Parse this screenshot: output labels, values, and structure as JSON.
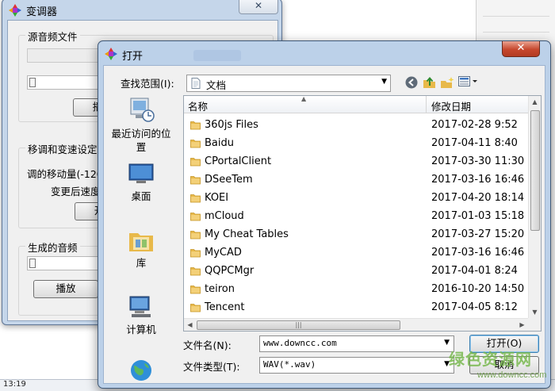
{
  "tuner": {
    "title": "变调器",
    "close_glyph": "✕",
    "source_group": "源音频文件",
    "shift_group": "移调和变速设定",
    "shift_label": "调的移动量(-120",
    "speed_label": "变更后速度",
    "output_group": "生成的音频",
    "play_button": "播放",
    "button_fragment_1": "播",
    "button_fragment_2": "开"
  },
  "dialog": {
    "title": "打开",
    "close_glyph": "✕",
    "lookin_label": "查找范围(I):",
    "lookin_value": "文档",
    "places": [
      {
        "label": "最近访问的位置"
      },
      {
        "label": "桌面"
      },
      {
        "label": "库"
      },
      {
        "label": "计算机"
      }
    ],
    "columns": {
      "name": "名称",
      "date": "修改日期"
    },
    "files": [
      {
        "name": "360js Files",
        "date": "2017-02-28 9:52"
      },
      {
        "name": "Baidu",
        "date": "2017-04-11 8:40"
      },
      {
        "name": "CPortalClient",
        "date": "2017-03-30 11:30"
      },
      {
        "name": "DSeeTem",
        "date": "2017-03-16 16:46"
      },
      {
        "name": "KOEI",
        "date": "2017-04-20 18:14"
      },
      {
        "name": "mCloud",
        "date": "2017-01-03 15:18"
      },
      {
        "name": "My Cheat Tables",
        "date": "2017-03-27 15:20"
      },
      {
        "name": "MyCAD",
        "date": "2017-03-16 16:46"
      },
      {
        "name": "QQPCMgr",
        "date": "2017-04-01 8:24"
      },
      {
        "name": "teiron",
        "date": "2016-10-20 14:50"
      },
      {
        "name": "Tencent",
        "date": "2017-04-05 8:12"
      }
    ],
    "filename_label": "文件名(N):",
    "filename_value": "www.downcc.com",
    "filetype_label": "文件类型(T):",
    "filetype_value": "WAV(*.wav)",
    "open_button": "打开(O)",
    "cancel_button": "取消"
  },
  "taskbar": {
    "time": "13:19"
  },
  "watermark": {
    "line1": "绿色资源网",
    "line2": "www.downcc.com"
  },
  "colors": {
    "folder": "#e8b94a",
    "dialog_frame": "#bcd1e9",
    "close_red": "#c6472d"
  }
}
